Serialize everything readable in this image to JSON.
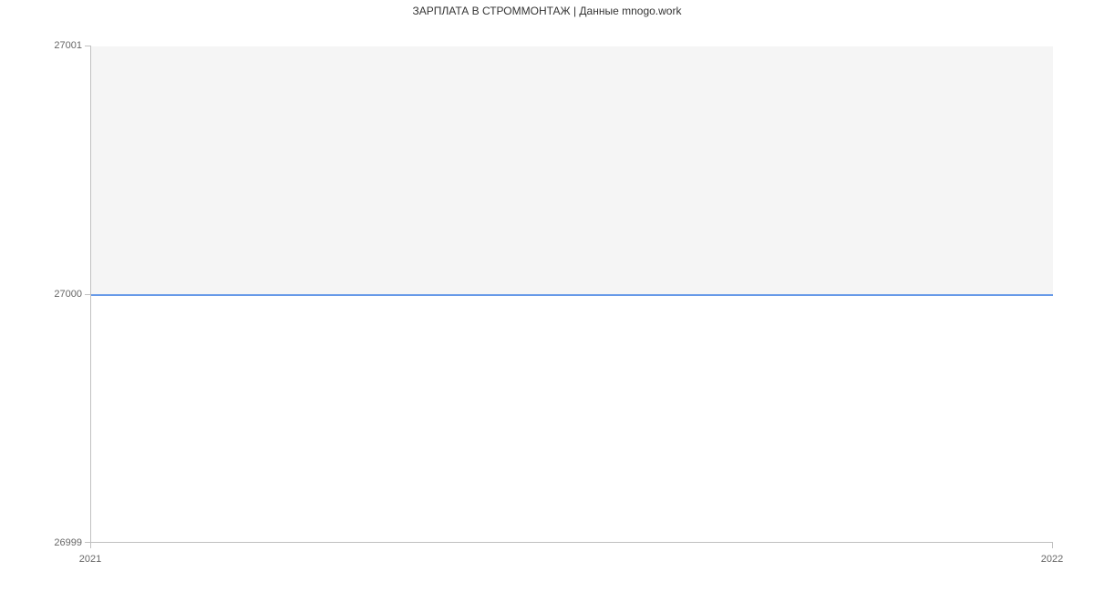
{
  "chart_data": {
    "type": "line",
    "title": "ЗАРПЛАТА В СТРОММОНТАЖ | Данные mnogo.work",
    "xlabel": "",
    "ylabel": "",
    "x": [
      2021,
      2022
    ],
    "values": [
      27000,
      27000
    ],
    "xlim": [
      2021,
      2022
    ],
    "ylim": [
      26999,
      27001
    ],
    "x_ticks": [
      2021,
      2022
    ],
    "y_ticks": [
      26999,
      27000,
      27001
    ],
    "grid": true,
    "line_color": "#6699e8",
    "fill_color": "#ffffff",
    "plot_bg": "#f5f5f5"
  },
  "title": "ЗАРПЛАТА В СТРОММОНТАЖ | Данные mnogo.work",
  "y_labels": {
    "t0": "26999",
    "t1": "27000",
    "t2": "27001"
  },
  "x_labels": {
    "t0": "2021",
    "t1": "2022"
  }
}
